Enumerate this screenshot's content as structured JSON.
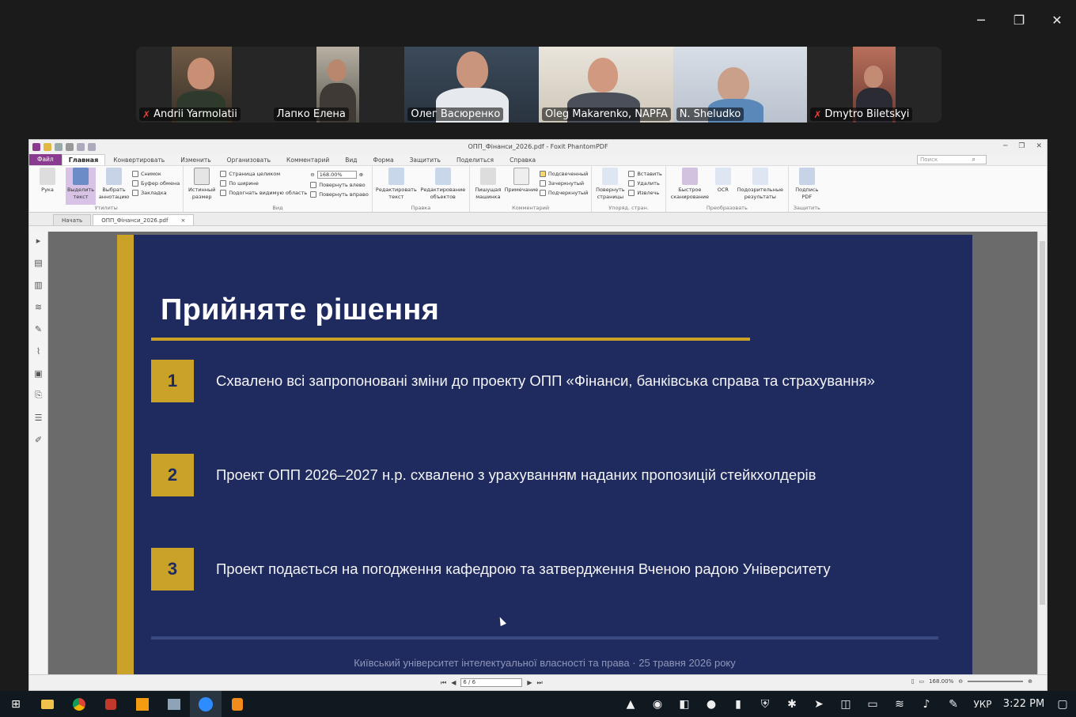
{
  "window_controls": {
    "minimize": "─",
    "restore": "❐",
    "close": "✕"
  },
  "participants": [
    {
      "name": "Andrii Yarmolatii",
      "muted": true
    },
    {
      "name": "Лапко Елена",
      "muted": false
    },
    {
      "name": "Олег Васюренко",
      "muted": false,
      "active_speaker": true
    },
    {
      "name": "Oleg Makarenko, NAPFA",
      "muted": false
    },
    {
      "name": "N. Sheludko",
      "muted": false
    },
    {
      "name": "Dmytro Biletskyi",
      "muted": true
    }
  ],
  "app": {
    "title": "ОПП_Фінанси_2026.pdf - Foxit PhantomPDF",
    "menu": {
      "file": "Файл",
      "home": "Главная",
      "items": [
        "Конвертировать",
        "Изменить",
        "Организовать",
        "Комментарий",
        "Вид",
        "Форма",
        "Защитить",
        "Поделиться",
        "Справка"
      ]
    },
    "search_placeholder": "Поиск",
    "ribbon": {
      "hand": "Рука",
      "select_text": "Выделить текст",
      "select_annotation": "Выбрать аннотацию",
      "snapshot": "Снимок",
      "clipboard": "Буфер обмена",
      "bookmark": "Закладка",
      "utilities_label": "Утилиты",
      "actual_size": "Истинный размер",
      "fit_page": "Страница целиком",
      "fit_width": "По ширине",
      "fit_visible": "Подогнать видимую область",
      "zoom_value": "168.00%",
      "rotate_left": "Повернуть влево",
      "rotate_right": "Повернуть вправо",
      "view_label": "Вид",
      "edit_text": "Редактировать текст",
      "edit_object": "Редактирование объектов",
      "edit_label": "Правка",
      "typewriter": "Пишущая машинка",
      "note": "Примечание",
      "highlight": "Подсвеченный",
      "strikeout": "Зачеркнутый",
      "underline": "Подчеркнутый",
      "comment_label": "Комментарий",
      "rotate_pages": "Повернуть страницы",
      "insert": "Вставить",
      "delete": "Удалить",
      "extract": "Извлечь",
      "pages_label": "Упоряд. стран.",
      "quick_scan": "Быстрое сканирование",
      "ocr": "OCR",
      "suspect_results": "Подозрительные результаты",
      "convert_label": "Преобразовать",
      "sign_pdf": "Подпись PDF",
      "protect_label": "Защитить"
    },
    "tabs": [
      {
        "label": "Начать",
        "active": false
      },
      {
        "label": "ОПП_Фінанси_2026.pdf",
        "active": true,
        "close": "×"
      }
    ],
    "status": {
      "page": "6 / 6",
      "zoom": "168.00%"
    }
  },
  "slide": {
    "title": "Прийняте рішення",
    "items": [
      {
        "num": "1",
        "text": "Схвалено всі запропоновані зміни до проекту ОПП «Фінанси, банківська справа та страхування»"
      },
      {
        "num": "2",
        "text": "Проект ОПП 2026–2027 н.р. схвалено з урахуванням наданих пропозицій стейкхолдерів"
      },
      {
        "num": "3",
        "text": "Проект подається на погодження кафедрою та затвердження Вченою радою Університету"
      }
    ],
    "footer": "Київський університет інтелектуальної власності та права · 25 травня 2026 року",
    "colors": {
      "background": "#1f2b5f",
      "accent": "#c9a227"
    }
  },
  "taskbar": {
    "apps": [
      "windows-start",
      "file-explorer",
      "chrome",
      "app-red",
      "app-orange",
      "app-tools",
      "zoom",
      "sublime"
    ],
    "language": "УКР",
    "time": "3:22 PM"
  }
}
